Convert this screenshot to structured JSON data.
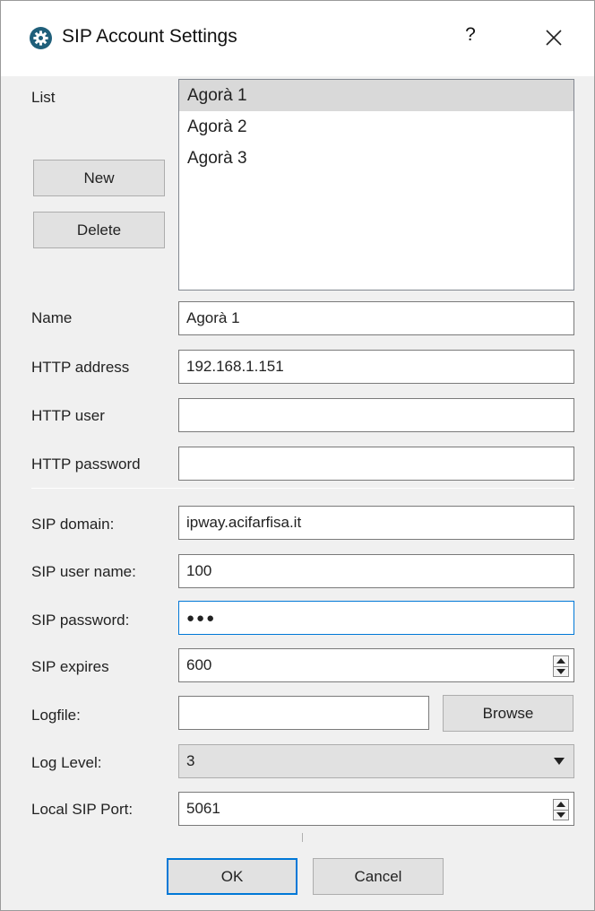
{
  "window": {
    "title": "SIP Account Settings",
    "help_label": "?",
    "icon": "gear-icon",
    "close_icon": "close-icon"
  },
  "list": {
    "label": "List",
    "items": [
      "Agorà 1",
      "Agorà 2",
      "Agorà 3"
    ],
    "selected": "Agorà 1"
  },
  "buttons": {
    "new": "New",
    "delete": "Delete",
    "browse": "Browse",
    "ok": "OK",
    "cancel": "Cancel"
  },
  "fields": {
    "name": {
      "label": "Name",
      "value": "Agorà 1"
    },
    "http_address": {
      "label": "HTTP address",
      "value": "192.168.1.151"
    },
    "http_user": {
      "label": "HTTP user",
      "value": ""
    },
    "http_password": {
      "label": "HTTP password",
      "value": ""
    },
    "sip_domain": {
      "label": "SIP domain:",
      "value": "ipway.acifarfisa.it"
    },
    "sip_user_name": {
      "label": "SIP user name:",
      "value": "100"
    },
    "sip_password": {
      "label": "SIP password:",
      "value": "●●●"
    },
    "sip_expires": {
      "label": "SIP expires",
      "value": "600"
    },
    "logfile": {
      "label": "Logfile:",
      "value": ""
    },
    "log_level": {
      "label": "Log Level:",
      "value": "3"
    },
    "local_sip_port": {
      "label": "Local SIP Port:",
      "value": "5061"
    }
  },
  "colors": {
    "focus_border": "#0078d7",
    "title_icon_bg": "#1f5f7a",
    "selected_item_bg": "#d9d9d9"
  }
}
